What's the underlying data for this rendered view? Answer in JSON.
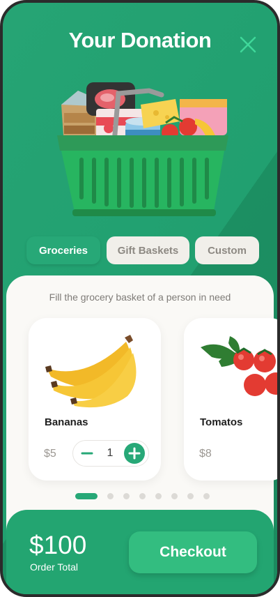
{
  "header": {
    "title": "Your Donation",
    "close_icon": "close-icon"
  },
  "hero": {
    "image": "grocery-basket-illustration"
  },
  "tabs": [
    {
      "label": "Groceries",
      "active": true
    },
    {
      "label": "Gift Baskets",
      "active": false
    },
    {
      "label": "Custom",
      "active": false
    }
  ],
  "subtitle": "Fill the grocery basket of a person in need",
  "products": [
    {
      "name": "Bananas",
      "price": "$5",
      "quantity": "1",
      "image": "bananas-illustration"
    },
    {
      "name": "Tomatos",
      "price": "$8",
      "image": "tomatoes-illustration"
    }
  ],
  "pagination": {
    "total": 9,
    "active_index": 0
  },
  "footer": {
    "total_amount": "$100",
    "total_label": "Order Total",
    "checkout_label": "Checkout"
  },
  "colors": {
    "primary_green": "#27a877",
    "dark_green": "#1b8a5f",
    "panel_bg": "#faf9f6",
    "inactive_tab_bg": "#f1efea",
    "muted_text": "#8d8983"
  }
}
